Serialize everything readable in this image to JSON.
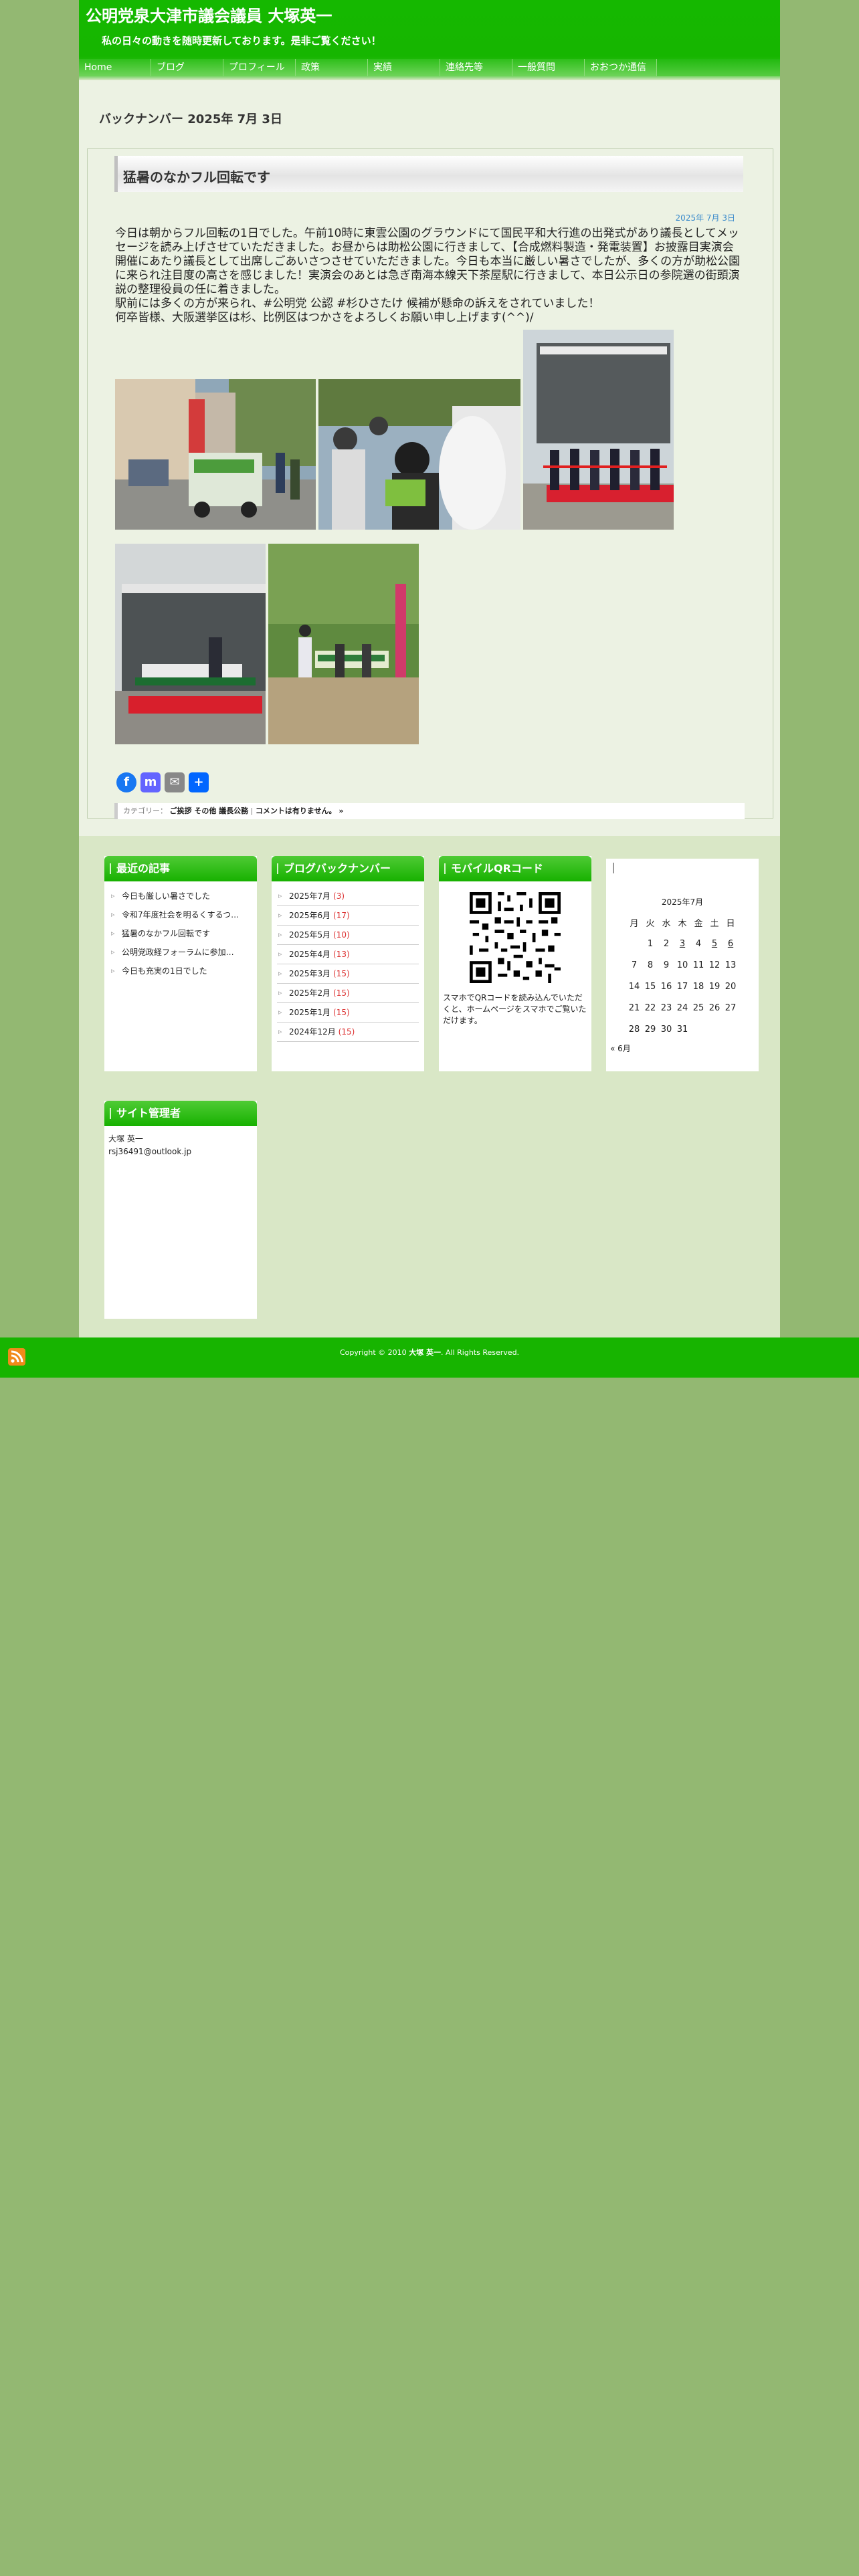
{
  "site": {
    "title": "公明党泉大津市議会議員 大塚英一",
    "description": "私の日々の動きを随時更新しております。是非ご覧ください！"
  },
  "nav": [
    "Home",
    "ブログ",
    "プロフィール",
    "政策",
    "実績",
    "連絡先等",
    "一般質問",
    "おおつか通信"
  ],
  "archive_title": "バックナンバー 2025年 7月 3日",
  "post": {
    "title": "猛暑のなかフル回転です",
    "date": "2025年 7月 3日",
    "body": [
      "今日は朝からフル回転の1日でした。午前10時に東雲公園のグラウンドにて国民平和大行進の出発式があり議長としてメッセージを読み上げさせていただきました。お昼からは助松公園に行きまして、【合成燃料製造・発電装置】お披露目実演会開催にあたり議長として出席しごあいさつさせていただきました。今日も本当に厳しい暑さでしたが、多くの方が助松公園に来られ注目度の高さを感じました！実演会のあとは急ぎ南海本線天下茶屋駅に行きまして、本日公示日の参院選の街頭演説の整理役員の任に着きました。",
      "駅前には多くの方が来られ、#公明党 公認 #杉ひさたけ 候補が懸命の訴えをされていました！",
      "何卒皆様、大阪選挙区は杉、比例区はつかさをよろしくお願い申し上げます(^^)/"
    ],
    "share": {
      "facebook": "f",
      "mastodon": "m",
      "email": "✉",
      "share": "+"
    },
    "category_label": "カテゴリー：",
    "categories": "ご挨拶 その他 議長公務",
    "comments": "コメントは有りません。 »"
  },
  "widgets": {
    "recent": {
      "title": "最近の記事",
      "items": [
        "今日も厳しい暑さでした",
        "令和7年度社会を明るくするつ…",
        "猛暑のなかフル回転です",
        "公明党政経フォーラムに参加…",
        "今日も充実の1日でした"
      ]
    },
    "archives": {
      "title": "ブログバックナンバー",
      "items": [
        {
          "label": "2025年7月",
          "count": "(3)"
        },
        {
          "label": "2025年6月",
          "count": "(17)"
        },
        {
          "label": "2025年5月",
          "count": "(10)"
        },
        {
          "label": "2025年4月",
          "count": "(13)"
        },
        {
          "label": "2025年3月",
          "count": "(15)"
        },
        {
          "label": "2025年2月",
          "count": "(15)"
        },
        {
          "label": "2025年1月",
          "count": "(15)"
        },
        {
          "label": "2024年12月",
          "count": "(15)"
        }
      ]
    },
    "qr": {
      "title": "モバイルQRコード",
      "text": "スマホでQRコードを読み込んでいただくと、ホームページをスマホでご覧いただけます。"
    },
    "calendar": {
      "caption": "2025年7月",
      "weekdays": [
        "月",
        "火",
        "水",
        "木",
        "金",
        "土",
        "日"
      ],
      "weeks": [
        [
          "",
          "1",
          "2",
          "3",
          "4",
          "5",
          "6"
        ],
        [
          "7",
          "8",
          "9",
          "10",
          "11",
          "12",
          "13"
        ],
        [
          "14",
          "15",
          "16",
          "17",
          "18",
          "19",
          "20"
        ],
        [
          "21",
          "22",
          "23",
          "24",
          "25",
          "26",
          "27"
        ],
        [
          "28",
          "29",
          "30",
          "31",
          "",
          "",
          ""
        ]
      ],
      "prev": "« 6月"
    },
    "admin": {
      "title": "サイト管理者",
      "name": "大塚 英一",
      "email": "rsj36491@outlook.jp"
    }
  },
  "footer": {
    "copyright_prefix": "Copyright © 2010",
    "owner": "大塚 英一",
    "copyright_suffix": ". All Rights Reserved."
  }
}
